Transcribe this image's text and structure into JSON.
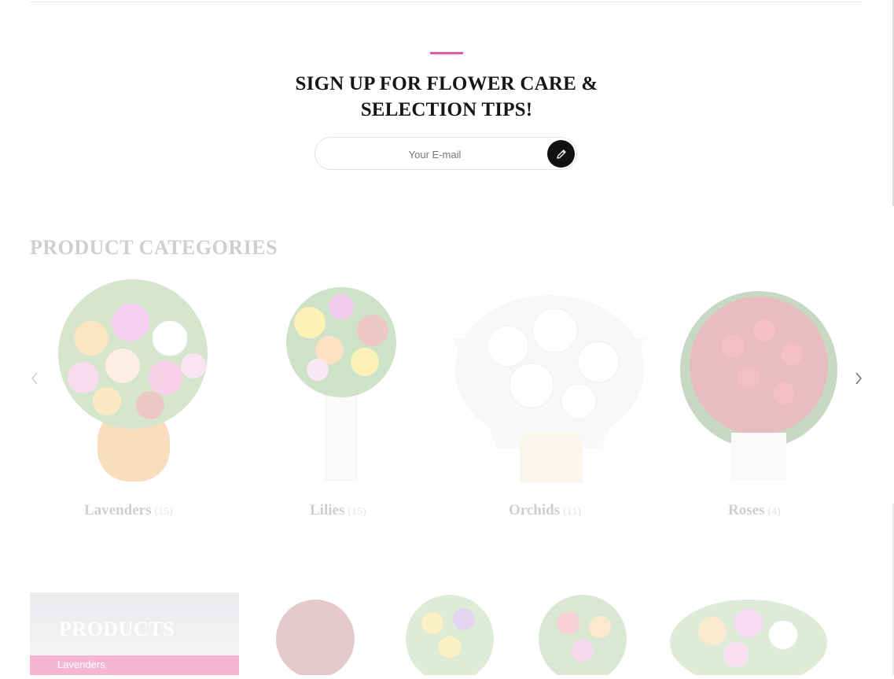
{
  "newsletter": {
    "title": "SIGN UP FOR FLOWER CARE & SELECTION TIPS!",
    "email_placeholder": "Your E-mail",
    "submit_icon": "pencil-icon"
  },
  "categories_section": {
    "title": "PRODUCT CATEGORIES",
    "prev_icon": "chevron-left-icon",
    "next_icon": "chevron-right-icon",
    "items": [
      {
        "label": "Lavenders",
        "count": "(15)"
      },
      {
        "label": "Lilies",
        "count": "(15)"
      },
      {
        "label": "Orchids",
        "count": "(11)"
      },
      {
        "label": "Roses",
        "count": "(4)"
      }
    ]
  },
  "products_section": {
    "title": "PRODUCTS",
    "sub_item": "Lavenders"
  },
  "colors": {
    "accent": "#e25ab1",
    "button": "#121212",
    "products_highlight": "#e84a8a"
  }
}
